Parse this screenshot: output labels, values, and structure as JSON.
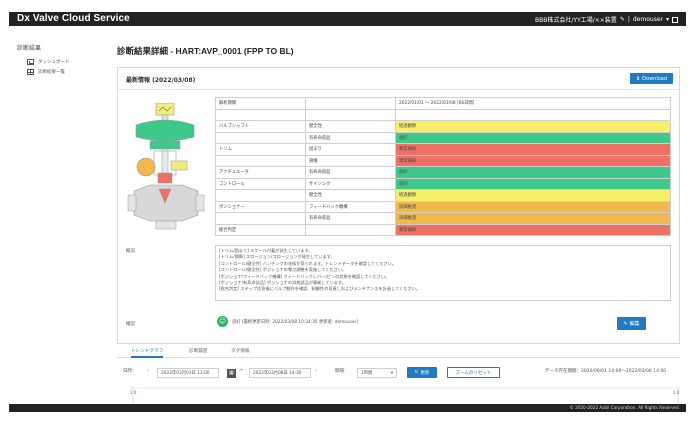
{
  "header": {
    "app_title": "Dx Valve Cloud Service",
    "company": "BBB株式会社/YY工場/××装置",
    "user": "demouser"
  },
  "sidebar": {
    "title": "診断結果",
    "items": [
      {
        "label": "ダッシュボード",
        "icon": "chart-icon"
      },
      {
        "label": "診断結果一覧",
        "icon": "grid-icon"
      }
    ]
  },
  "page": {
    "title": "診断結果詳細 - HART:AVP_0001 (FPP TO BL)"
  },
  "card": {
    "title": "最新情報 (2022/03/08)",
    "download_label": "Download",
    "diag_rows": [
      {
        "c1": "解析期間",
        "c2": "",
        "c3": "2022/01/01 ～ 2022/03/08 [66日間]",
        "status": "none"
      },
      {
        "c1": "",
        "c2": "",
        "c3": "",
        "status": "none"
      },
      {
        "c1": "バルブシャフト",
        "c2": "健全性",
        "c3": "経過観察",
        "status": "yellow"
      },
      {
        "c1": "",
        "c2": "有寿命部品",
        "c3": "良好",
        "status": "green"
      },
      {
        "c1": "トリム",
        "c2": "固まり",
        "c3": "異常検知",
        "status": "red"
      },
      {
        "c1": "",
        "c2": "損傷",
        "c3": "異常検知",
        "status": "red"
      },
      {
        "c1": "アクチュエータ",
        "c2": "有寿命部品",
        "c3": "良好",
        "status": "green"
      },
      {
        "c1": "コントロール",
        "c2": "サイジング",
        "c3": "良好",
        "status": "green"
      },
      {
        "c1": "",
        "c2": "健全性",
        "c3": "経過観察",
        "status": "yellow"
      },
      {
        "c1": "ポジショナー",
        "c2": "フィードバック機構",
        "c3": "詳細推奨",
        "status": "orange"
      },
      {
        "c1": "",
        "c2": "有寿命部品",
        "c3": "詳細推奨",
        "status": "orange"
      },
      {
        "c1": "総合判定",
        "c2": "",
        "c3": "異常検知",
        "status": "red"
      }
    ],
    "summary_label": "概況",
    "summary_lines": [
      "[トリム/固まり] スケール付着が発生しています。",
      "[トリム/損傷] エロージョン/コロージョンが発生しています。",
      "[コントロール/健全性] ハンチングの兆候が見られます。トレンドデータを確認してください。",
      "[コントロール/健全性] ポジショナの零点調整を実施してください。",
      "[ポジショナ/フィードバック機構] フィードバックレバー/ピンの状態を確認してください。",
      "[ポジショナ/有寿命部品] ポジショナの消耗部品が摩耗しています。",
      "[総合判定] ステップ応答後にバルブ動作を確認、制御性の見直しおよびメンテナンスを計画してください。"
    ],
    "confirm_label": "確認",
    "confirm_text": "良好 [最終更新日時: 2022/03/08 10:34:35 更新者: demouser]",
    "edit_label": "編集"
  },
  "tabs": [
    {
      "label": "トレンドグラフ",
      "active": true
    },
    {
      "label": "診断履歴",
      "active": false
    },
    {
      "label": "タグ情報",
      "active": false
    }
  ],
  "filter": {
    "period_label": "日時：",
    "start": "2022年03月03日 13:00",
    "end": "2022年03月08日 14:30",
    "interval_label": "間隔：",
    "interval": "1時間",
    "update_label": "更新",
    "zoom_reset_label": "ズームのリセット",
    "data_period": "データ存在期間：2020/06/01 14:00～2022/03/08 14:00"
  },
  "chart_axis": {
    "y_top_left": "1.0",
    "y_top_right": "1.0"
  },
  "footer": {
    "copyright": "© 2020-2022 Azbil Corporation. All Rights Reserved."
  }
}
